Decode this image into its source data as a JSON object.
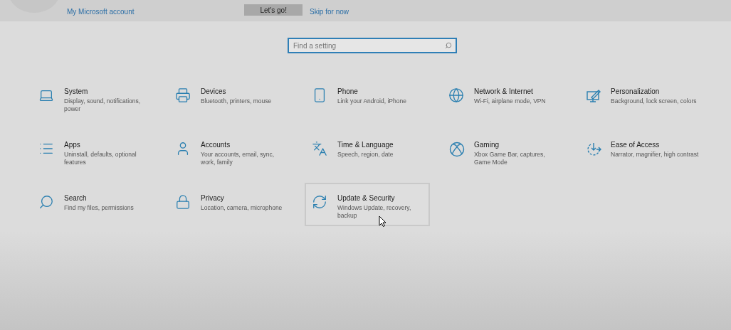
{
  "banner": {
    "account_link": "My Microsoft account",
    "primary_button": "Let's go!",
    "skip_link": "Skip for now"
  },
  "search": {
    "placeholder": "Find a setting"
  },
  "categories": [
    {
      "title": "System",
      "description": "Display, sound, notifications, power",
      "hovered": false
    },
    {
      "title": "Devices",
      "description": "Bluetooth, printers, mouse",
      "hovered": false
    },
    {
      "title": "Phone",
      "description": "Link your Android, iPhone",
      "hovered": false
    },
    {
      "title": "Network & Internet",
      "description": "Wi-Fi, airplane mode, VPN",
      "hovered": false
    },
    {
      "title": "Personalization",
      "description": "Background, lock screen, colors",
      "hovered": false
    },
    {
      "title": "Apps",
      "description": "Uninstall, defaults, optional features",
      "hovered": false
    },
    {
      "title": "Accounts",
      "description": "Your accounts, email, sync, work, family",
      "hovered": false
    },
    {
      "title": "Time & Language",
      "description": "Speech, region, date",
      "hovered": false
    },
    {
      "title": "Gaming",
      "description": "Xbox Game Bar, captures, Game Mode",
      "hovered": false
    },
    {
      "title": "Ease of Access",
      "description": "Narrator, magnifier, high contrast",
      "hovered": false
    },
    {
      "title": "Search",
      "description": "Find my files, permissions",
      "hovered": false
    },
    {
      "title": "Privacy",
      "description": "Location, camera, microphone",
      "hovered": false
    },
    {
      "title": "Update & Security",
      "description": "Windows Update, recovery, backup",
      "hovered": true
    }
  ]
}
